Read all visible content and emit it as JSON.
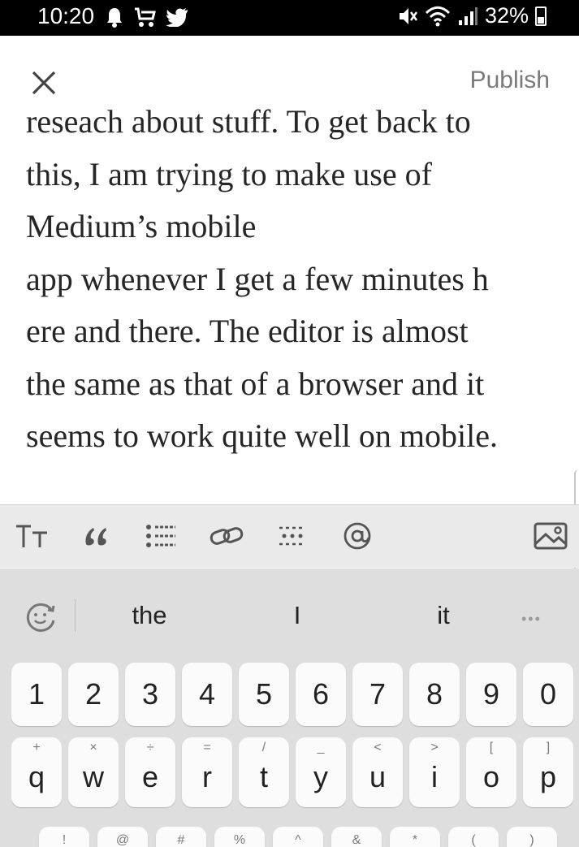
{
  "status_bar": {
    "time": "10:20",
    "battery": "32%"
  },
  "header": {
    "publish_label": "Publish"
  },
  "editor": {
    "lines": [
      "reseach about stuff. To get back to",
      "this, I am trying to make use of",
      "Medium’s mobile",
      "app whenever I get a few minutes h",
      "ere and there. The editor is almost",
      "the same as that of a browser and it",
      "seems to work quite well on mobile."
    ]
  },
  "toolbar": {
    "text_size_label": "TT",
    "quote_label": "“",
    "mention_label": "@"
  },
  "suggestions": {
    "items": [
      "the",
      "I",
      "it"
    ],
    "more_label": "•••"
  },
  "keyboard": {
    "number_row": [
      "1",
      "2",
      "3",
      "4",
      "5",
      "6",
      "7",
      "8",
      "9",
      "0"
    ],
    "letter_row": [
      {
        "main": "q",
        "sub": "+"
      },
      {
        "main": "w",
        "sub": "×"
      },
      {
        "main": "e",
        "sub": "÷"
      },
      {
        "main": "r",
        "sub": "="
      },
      {
        "main": "t",
        "sub": "/"
      },
      {
        "main": "y",
        "sub": "_"
      },
      {
        "main": "u",
        "sub": "<"
      },
      {
        "main": "i",
        "sub": ">"
      },
      {
        "main": "o",
        "sub": "["
      },
      {
        "main": "p",
        "sub": "]"
      }
    ],
    "partial_row_subs": [
      "!",
      "@",
      "#",
      "%",
      "^",
      "&",
      "*",
      "(",
      ")"
    ]
  }
}
